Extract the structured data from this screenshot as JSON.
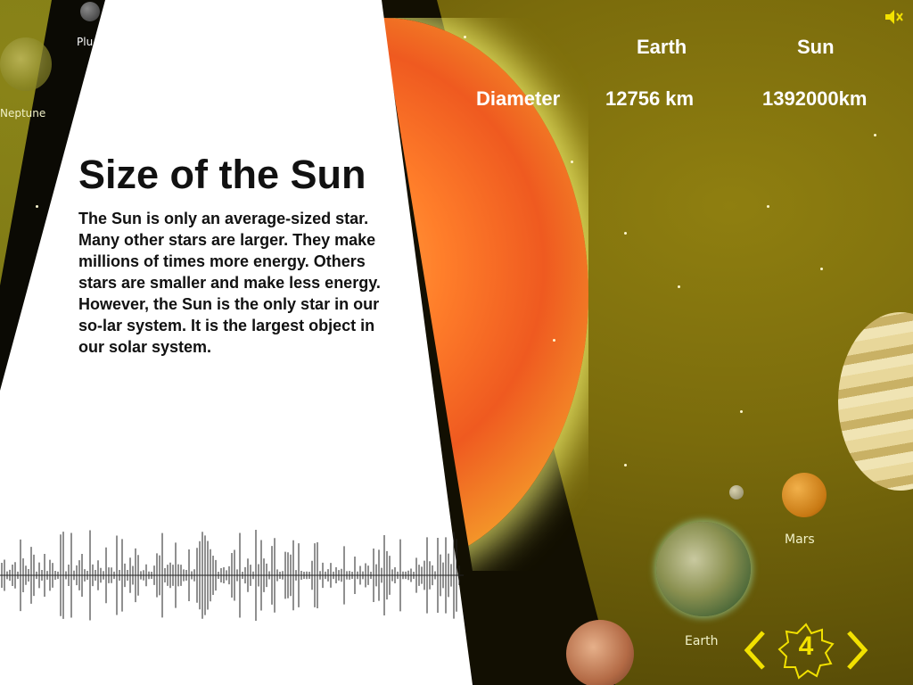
{
  "comparison": {
    "col_earth": "Earth",
    "col_sun": "Sun",
    "row_label": "Diameter",
    "earth_value": "12756 km",
    "sun_value": "1392000km"
  },
  "content": {
    "title": "Size of the Sun",
    "body": "The Sun is only an average-sized star. Many other stars are larger. They make millions of times more energy. Others stars are smaller and make less energy. However, the Sun is the only star in our so-lar system. It is the largest object in our solar system."
  },
  "planet_labels": {
    "neptune": "Neptune",
    "pluto": "Plu",
    "mars": "Mars",
    "earth": "Earth"
  },
  "navigation": {
    "page": "4",
    "prev_icon": "chevron-left-icon",
    "next_icon": "chevron-right-icon"
  },
  "audio": {
    "icon": "speaker-mute-icon"
  },
  "colors": {
    "accent": "#f2e100",
    "panel": "#ffffff",
    "space": "#7a6b0c"
  }
}
